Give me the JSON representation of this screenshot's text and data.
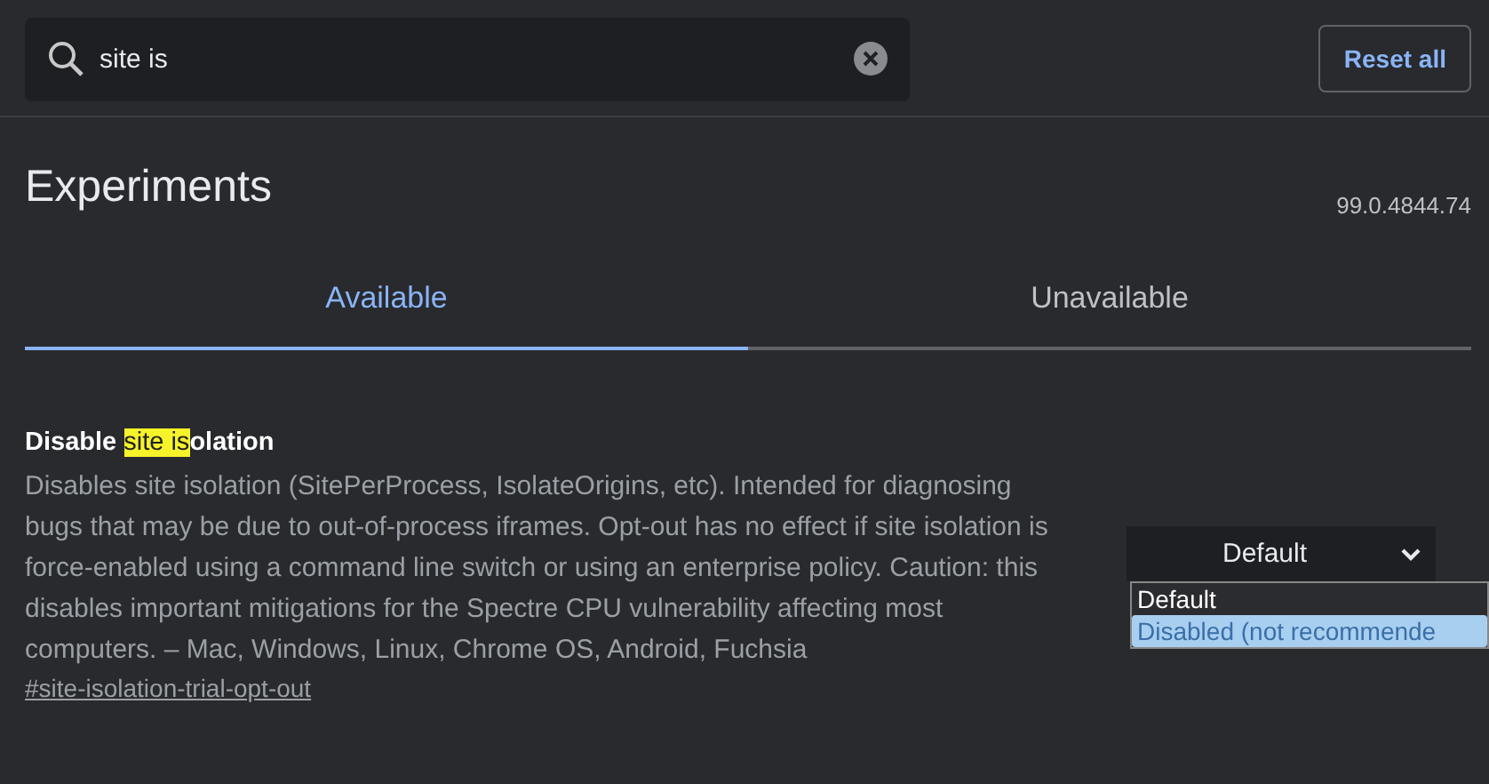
{
  "search": {
    "value": "site is"
  },
  "reset_button": "Reset all",
  "title": "Experiments",
  "version": "99.0.4844.74",
  "tabs": [
    {
      "label": "Available",
      "selected": true
    },
    {
      "label": "Unavailable",
      "selected": false
    }
  ],
  "experiment": {
    "title_parts": [
      {
        "text": "Disable ",
        "highlighted": false
      },
      {
        "text": "site is",
        "highlighted": true
      },
      {
        "text": "olation",
        "highlighted": false
      }
    ],
    "description": "Disables site isolation (SitePerProcess, IsolateOrigins, etc). Intended for diagnosing bugs that may be due to out-of-process iframes. Opt-out has no effect if site isolation is force-enabled using a command line switch or using an enterprise policy. Caution: this disables important mitigations for the Spectre CPU vulnerability affecting most computers. – Mac, Windows, Linux, Chrome OS, Android, Fuchsia",
    "link": "#site-isolation-trial-opt-out",
    "select": {
      "value": "Default",
      "options": [
        {
          "label": "Default",
          "highlighted": false
        },
        {
          "label": "Disabled (not recommende",
          "highlighted": true
        }
      ]
    }
  }
}
